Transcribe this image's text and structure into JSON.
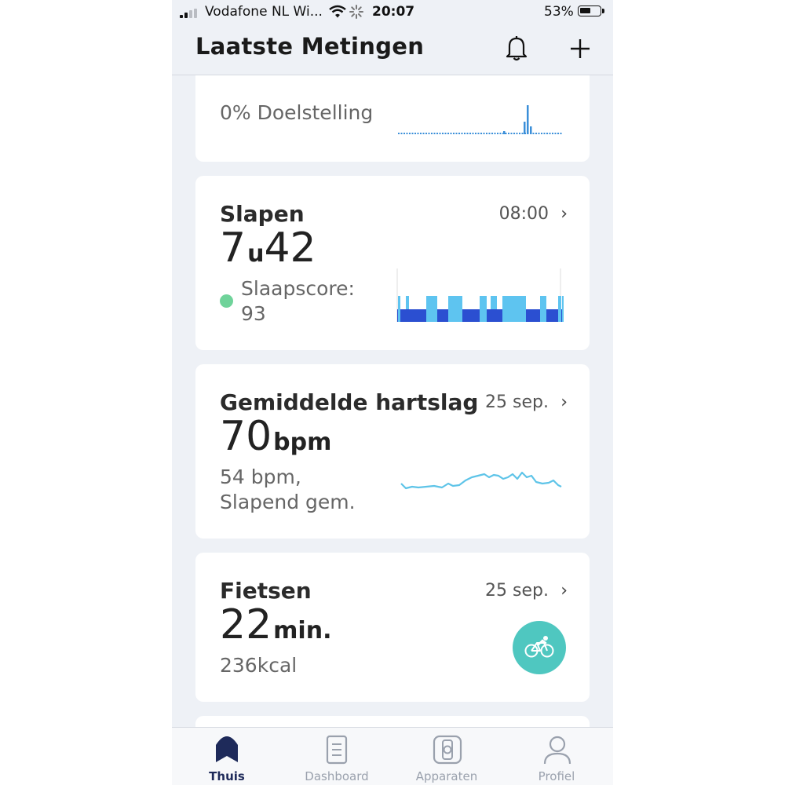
{
  "status_bar": {
    "carrier": "Vodafone NL Wi...",
    "time": "20:07",
    "battery": "53%"
  },
  "header": {
    "title": "Laatste Metingen",
    "bell_icon": "bell-icon",
    "add_icon": "plus-icon"
  },
  "cards": {
    "activity": {
      "goal_text": "0% Doelstelling"
    },
    "sleep": {
      "title": "Slapen",
      "time": "08:00",
      "value": "7",
      "unit_mid": "u",
      "value2": "42",
      "score_label": "Slaapscore:",
      "score_value": "93",
      "score_color": "#6fd39a"
    },
    "heart": {
      "title": "Gemiddelde hartslag",
      "date": "25 sep.",
      "value": "70",
      "unit": "bpm",
      "sub_line1": "54 bpm,",
      "sub_line2": "Slapend gem."
    },
    "cycling": {
      "title": "Fietsen",
      "date": "25 sep.",
      "value": "22",
      "unit": "min.",
      "kcal": "236kcal",
      "icon": "bicycle-icon"
    }
  },
  "tabs": [
    {
      "label": "Thuis",
      "icon": "home-icon",
      "active": true
    },
    {
      "label": "Dashboard",
      "icon": "dashboard-icon",
      "active": false
    },
    {
      "label": "Apparaten",
      "icon": "watch-icon",
      "active": false
    },
    {
      "label": "Profiel",
      "icon": "profile-icon",
      "active": false
    }
  ],
  "colors": {
    "accent_dark": "#1e2a5a",
    "sleep_light": "#5ec4f0",
    "sleep_deep": "#2b4fd1",
    "heart_line": "#5ec4e8",
    "cycling_bg": "#4fc7c0"
  }
}
